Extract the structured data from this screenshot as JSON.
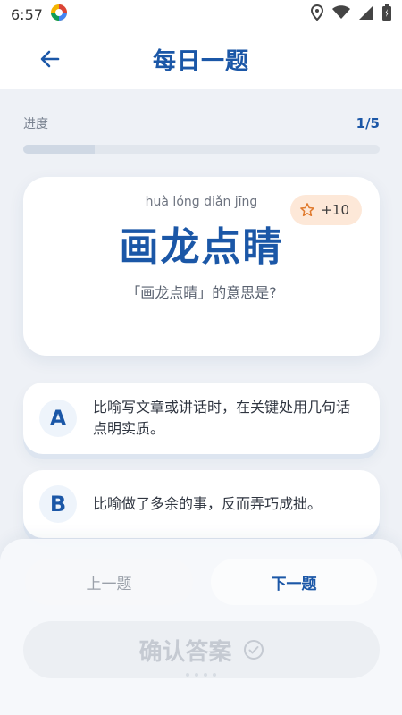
{
  "status_bar": {
    "time": "6:57"
  },
  "app_bar": {
    "title": "每日一题"
  },
  "progress": {
    "label": "进度",
    "count": "1/5",
    "fraction": 0.2
  },
  "question_card": {
    "pinyin": "huà lóng diǎn jīng",
    "idiom": "画龙点睛",
    "question": "「画龙点睛」的意思是?",
    "points": "+10"
  },
  "options": [
    {
      "letter": "A",
      "text": "比喻写文章或讲话时，在关键处用几句话点明实质。"
    },
    {
      "letter": "B",
      "text": "比喻做了多余的事，反而弄巧成拙。"
    }
  ],
  "navigation": {
    "prev_label": "上一题",
    "next_label": "下一题"
  },
  "confirm": {
    "label": "确认答案"
  },
  "colors": {
    "primary": "#1b57a7",
    "badge_bg": "#fde8d8",
    "star": "#e07a2e"
  }
}
